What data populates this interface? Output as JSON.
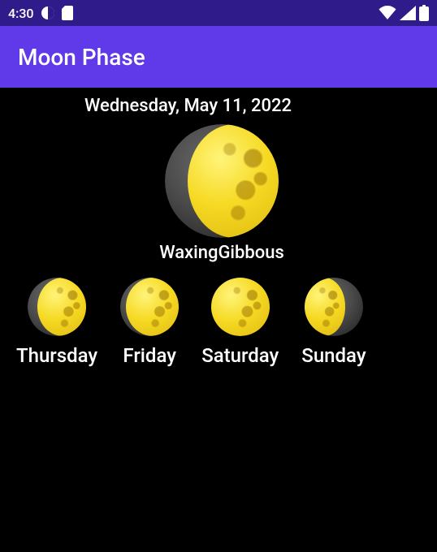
{
  "status_bar": {
    "time": "4:30",
    "icons_left": [
      "contrast-circle-icon",
      "sd-card-icon"
    ],
    "icons_right": [
      "wifi-icon",
      "signal-icon",
      "battery-icon"
    ]
  },
  "app_bar": {
    "title": "Moon Phase"
  },
  "today": {
    "date": "Wednesday, May 11, 2022",
    "phase_name": "WaxingGibbous",
    "phase_kind": "waxing-gibbous"
  },
  "forecast": [
    {
      "day": "Thursday",
      "phase_kind": "waxing-gibbous"
    },
    {
      "day": "Friday",
      "phase_kind": "waxing-gibbous"
    },
    {
      "day": "Saturday",
      "phase_kind": "full"
    },
    {
      "day": "Sunday",
      "phase_kind": "waning-gibbous"
    }
  ]
}
